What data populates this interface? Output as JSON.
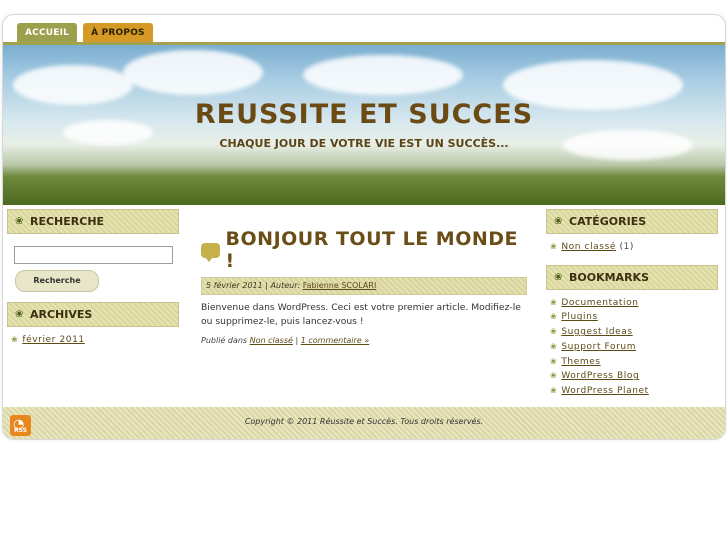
{
  "nav": {
    "items": [
      {
        "label": "ACCUEIL"
      },
      {
        "label": "À PROPOS"
      }
    ]
  },
  "site": {
    "title": "REUSSITE ET SUCCES",
    "tagline": "CHAQUE JOUR DE VOTRE VIE EST UN SUCCÈS..."
  },
  "left_sidebar": {
    "search": {
      "title": "RECHERCHE",
      "input_value": "",
      "button_label": "Recherche"
    },
    "archives": {
      "title": "ARCHIVES",
      "items": [
        {
          "label": "février 2011"
        }
      ]
    }
  },
  "post": {
    "title": "BONJOUR TOUT LE MONDE !",
    "date": "5 février 2011",
    "author_prefix": "| Auteur:",
    "author": "Fabienne SCOLARI",
    "body": "Bienvenue dans WordPress. Ceci est votre premier article. Modifiez-le ou supprimez-le, puis lancez-vous !",
    "published_in": "Publié dans",
    "category": "Non classé",
    "separator": "|",
    "comments": "1 commentaire »"
  },
  "right_sidebar": {
    "categories": {
      "title": "CATÉGORIES",
      "items": [
        {
          "label": "Non classé",
          "count": "(1)"
        }
      ]
    },
    "bookmarks": {
      "title": "BOOKMARKS",
      "items": [
        {
          "label": "Documentation"
        },
        {
          "label": "Plugins"
        },
        {
          "label": "Suggest Ideas"
        },
        {
          "label": "Support Forum"
        },
        {
          "label": "Themes"
        },
        {
          "label": "WordPress Blog"
        },
        {
          "label": "WordPress Planet"
        }
      ]
    }
  },
  "footer": {
    "copyright": "Copyright © 2011 Réussite et Succès. Tous droits réservés.",
    "rss_label": "RSS"
  },
  "colors": {
    "nav_home": "#9aa04c",
    "nav_about": "#d49a25",
    "title": "#6b4a14",
    "link": "#5c4a16"
  }
}
